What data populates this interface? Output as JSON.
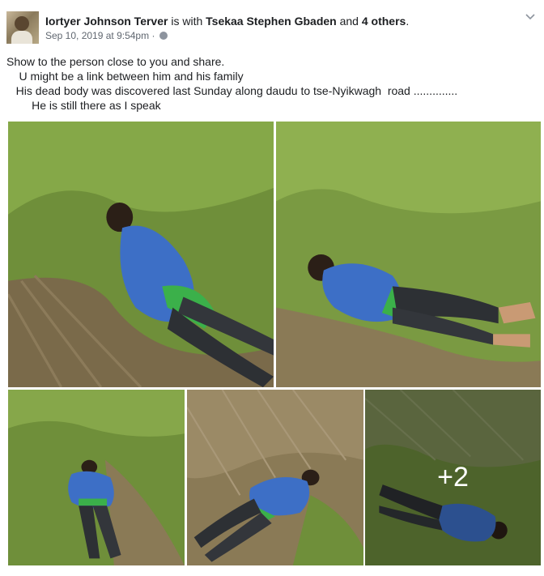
{
  "post": {
    "author": "Iortyer Johnson Terver",
    "with_text": "is with",
    "tagged": "Tsekaa Stephen Gbaden",
    "and_text": "and",
    "others": "4 others",
    "period": ".",
    "timestamp": "Sep 10, 2019 at 9:54pm",
    "separator": "·",
    "privacy_icon": "globe-icon",
    "menu_icon": "chevron-down-icon",
    "text_lines": [
      "Show to the person close to you and share.",
      "    U might be a link between him and his family",
      "   His dead body was discovered last Sunday along daudu to tse-Nyikwagh  road ..............",
      "        He is still there as I speak"
    ]
  },
  "photos": {
    "more_count": "+2"
  },
  "colors": {
    "text": "#1c1e21",
    "meta": "#606770",
    "grass": "#6d8a3a",
    "shirt": "#3d6fc6"
  }
}
